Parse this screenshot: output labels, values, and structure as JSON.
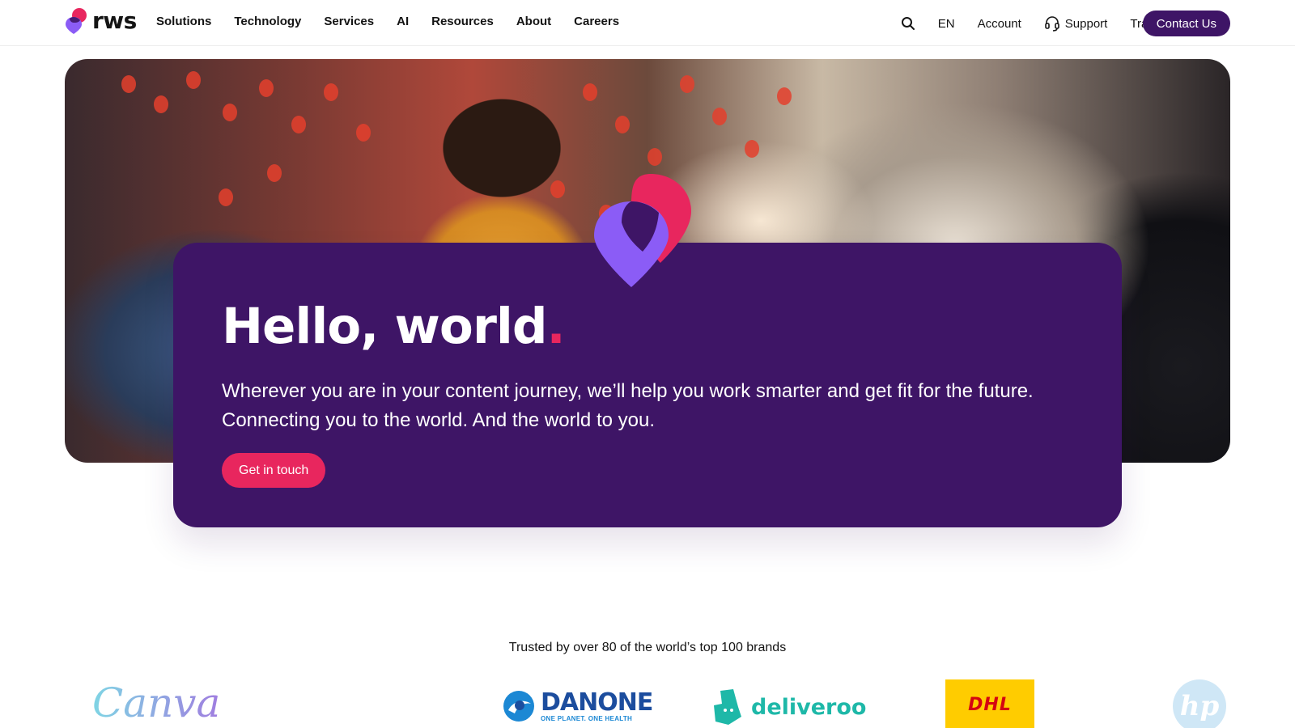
{
  "brand": {
    "name": "rws"
  },
  "nav": {
    "items": [
      {
        "label": "Solutions"
      },
      {
        "label": "Technology"
      },
      {
        "label": "Services"
      },
      {
        "label": "AI"
      },
      {
        "label": "Resources"
      },
      {
        "label": "About"
      },
      {
        "label": "Careers"
      }
    ]
  },
  "utility": {
    "search_icon": "search-icon",
    "language": "EN",
    "account": "Account",
    "support": "Support",
    "support_icon": "headset-icon",
    "translate": "Translate now",
    "contact": "Contact Us"
  },
  "hero": {
    "title": "Hello, world",
    "title_dot": ".",
    "subtitle": "Wherever you are in your content journey, we’ll help you work smarter and get fit for the future. Connecting you to the world. And the world to you.",
    "cta": "Get in touch"
  },
  "trusted": {
    "text": "Trusted by over 80 of the world’s top 100 brands",
    "brands": {
      "canva": "Canva",
      "danone": "DANONE",
      "danone_tag": "ONE PLANET. ONE HEALTH",
      "deliveroo": "deliveroo",
      "dhl": "DHL",
      "hp": "hp"
    }
  },
  "colors": {
    "primary_purple": "#3e1566",
    "accent_pink": "#e8265e",
    "accent_violet": "#8b5cf6"
  }
}
